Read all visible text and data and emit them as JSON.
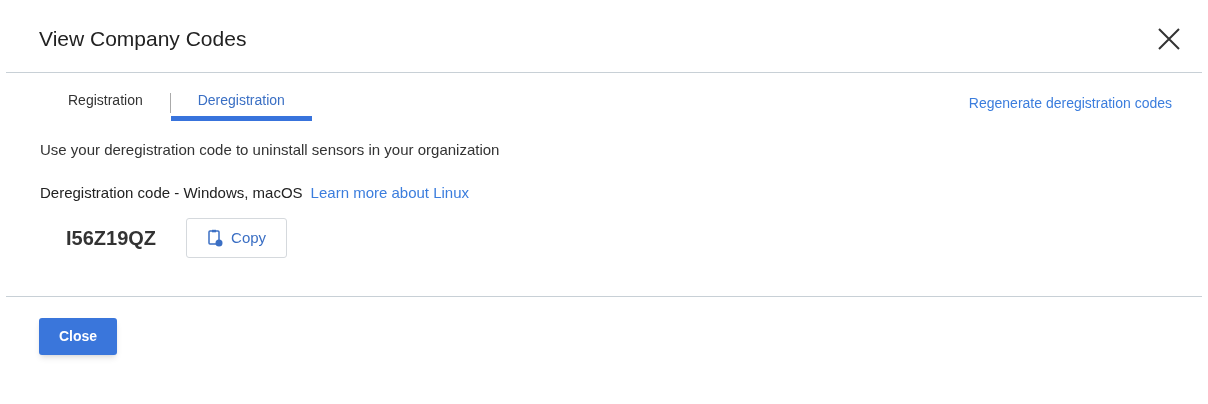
{
  "dialog": {
    "title": "View Company Codes"
  },
  "tabs": [
    {
      "label": "Registration",
      "selected": false
    },
    {
      "label": "Deregistration",
      "selected": true
    }
  ],
  "regenerate_link": "Regenerate deregistration codes",
  "description": "Use your deregistration code to uninstall sensors in your organization",
  "code_label": "Deregistration code - Windows, macOS",
  "linux_link": "Learn more about Linux",
  "code": "I56Z19QZ",
  "copy_button": "Copy",
  "close_button": "Close"
}
